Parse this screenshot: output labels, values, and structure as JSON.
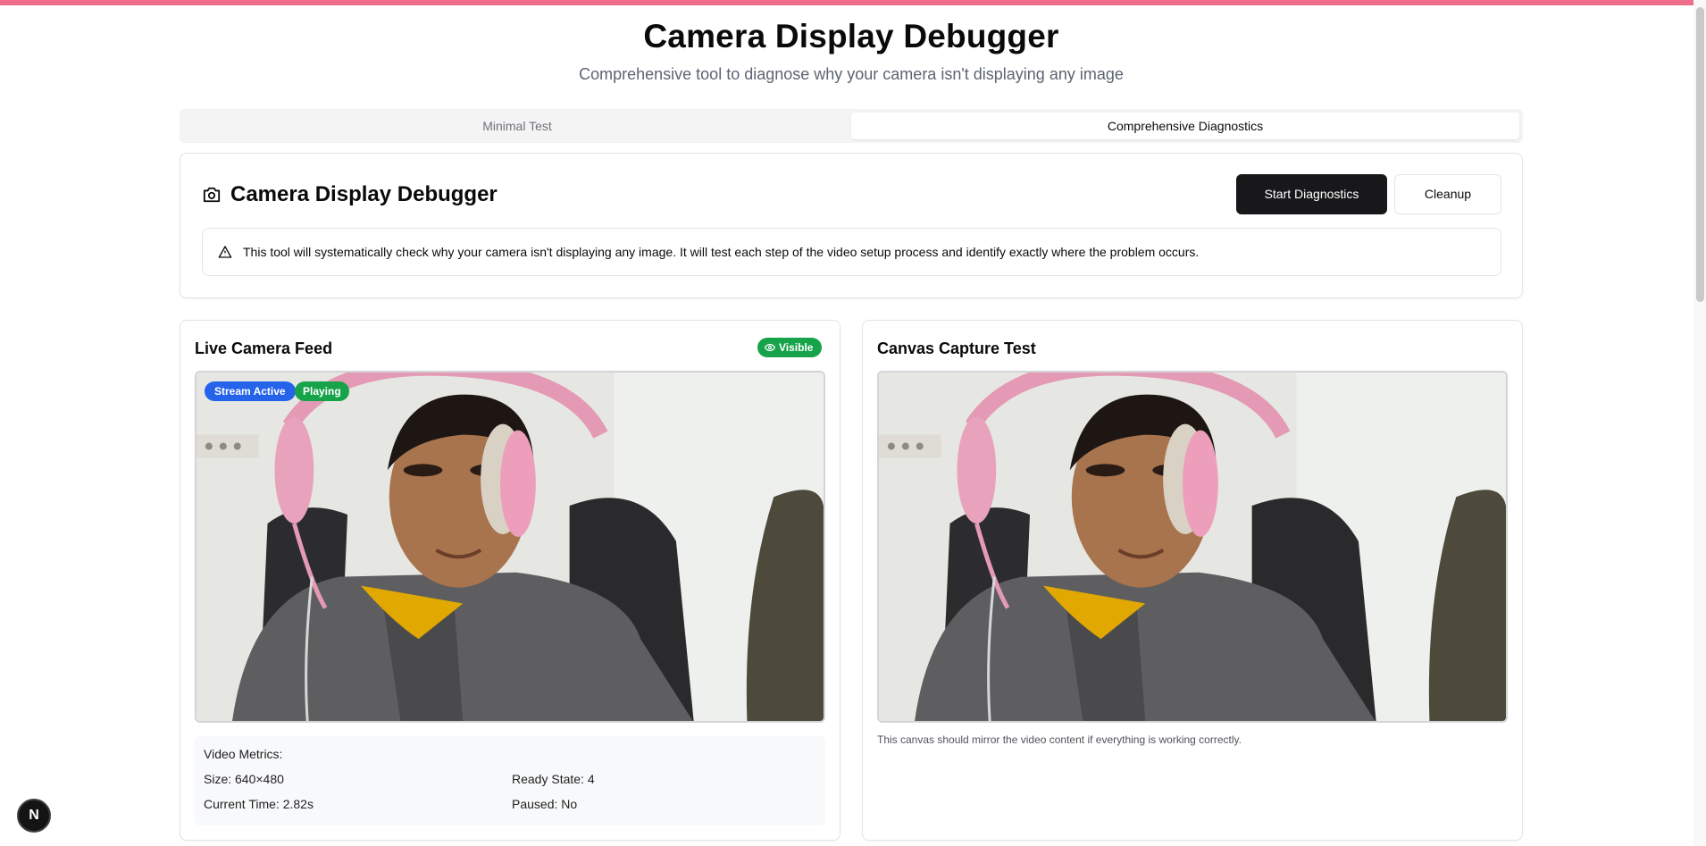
{
  "page": {
    "title": "Camera Display Debugger",
    "subtitle": "Comprehensive tool to diagnose why your camera isn't displaying any image"
  },
  "tabs": [
    {
      "label": "Minimal Test",
      "active": false
    },
    {
      "label": "Comprehensive Diagnostics",
      "active": true
    }
  ],
  "debugger": {
    "title": "Camera Display Debugger",
    "icon": "camera-icon",
    "start_button": "Start Diagnostics",
    "cleanup_button": "Cleanup",
    "alert_icon": "warning-triangle-icon",
    "alert_text": "This tool will systematically check why your camera isn't displaying any image. It will test each step of the video setup process and identify exactly where the problem occurs."
  },
  "live_feed": {
    "title": "Live Camera Feed",
    "visibility_badge": "Visible",
    "visibility_icon": "eye-icon",
    "stream_badge": "Stream Active",
    "playing_badge": "Playing",
    "metrics": {
      "title": "Video Metrics:",
      "size": "Size: 640×480",
      "ready_state": "Ready State: 4",
      "current_time": "Current Time: 2.82s",
      "paused": "Paused: No"
    }
  },
  "canvas_test": {
    "title": "Canvas Capture Test",
    "caption": "This canvas should mirror the video content if everything is working correctly."
  },
  "dev_badge": {
    "label": "N"
  },
  "colors": {
    "top_accent": "#ee6d8a",
    "primary_button": "#18181b",
    "stream_badge": "#2563eb",
    "success_badge": "#16a34a"
  }
}
